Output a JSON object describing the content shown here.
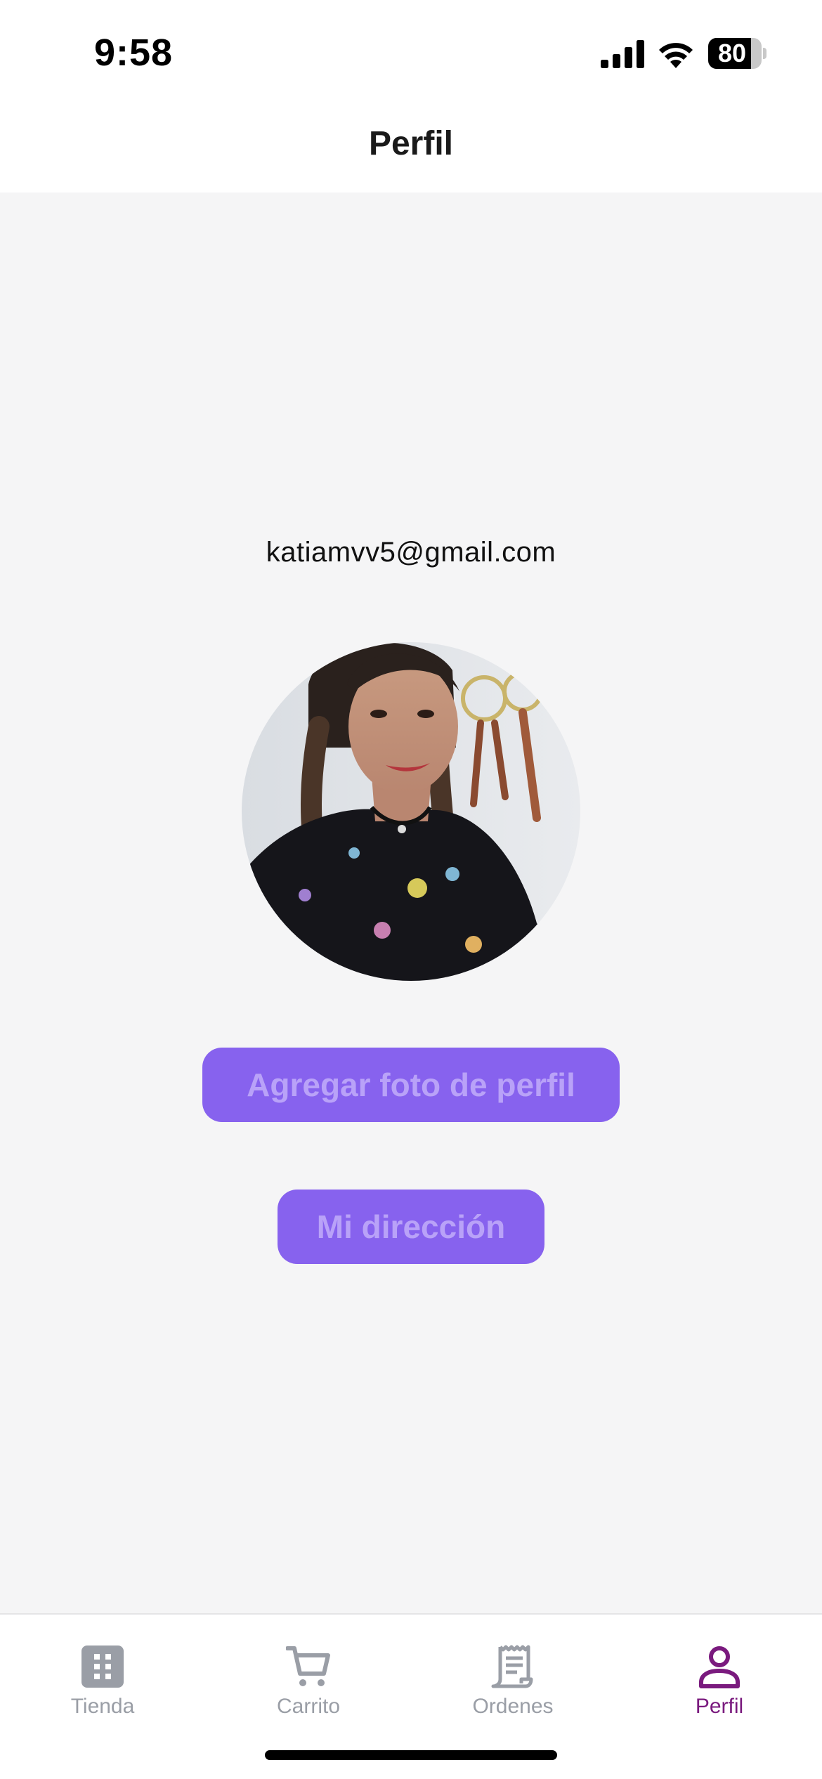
{
  "status_bar": {
    "time": "9:58",
    "battery_level": "80",
    "battery_fraction": 0.8,
    "icons": [
      "signal-icon",
      "wifi-icon",
      "battery-icon"
    ]
  },
  "header": {
    "title": "Perfil"
  },
  "profile": {
    "email": "katiamvv5@gmail.com",
    "avatar": "profile-photo"
  },
  "actions": {
    "add_photo_label": "Agregar foto de perfil",
    "address_label": "Mi dirección"
  },
  "tab_bar": {
    "items": [
      {
        "label": "Tienda",
        "icon": "grid-icon",
        "active": false
      },
      {
        "label": "Carrito",
        "icon": "cart-icon",
        "active": false
      },
      {
        "label": "Ordenes",
        "icon": "receipt-icon",
        "active": false
      },
      {
        "label": "Perfil",
        "icon": "user-icon",
        "active": true
      }
    ]
  },
  "colors": {
    "accent": "#8762ee",
    "button_text": "#b9a2f8",
    "active_tab": "#7a1a7e",
    "inactive_tab": "#9a9ea6",
    "background": "#f5f5f6"
  }
}
